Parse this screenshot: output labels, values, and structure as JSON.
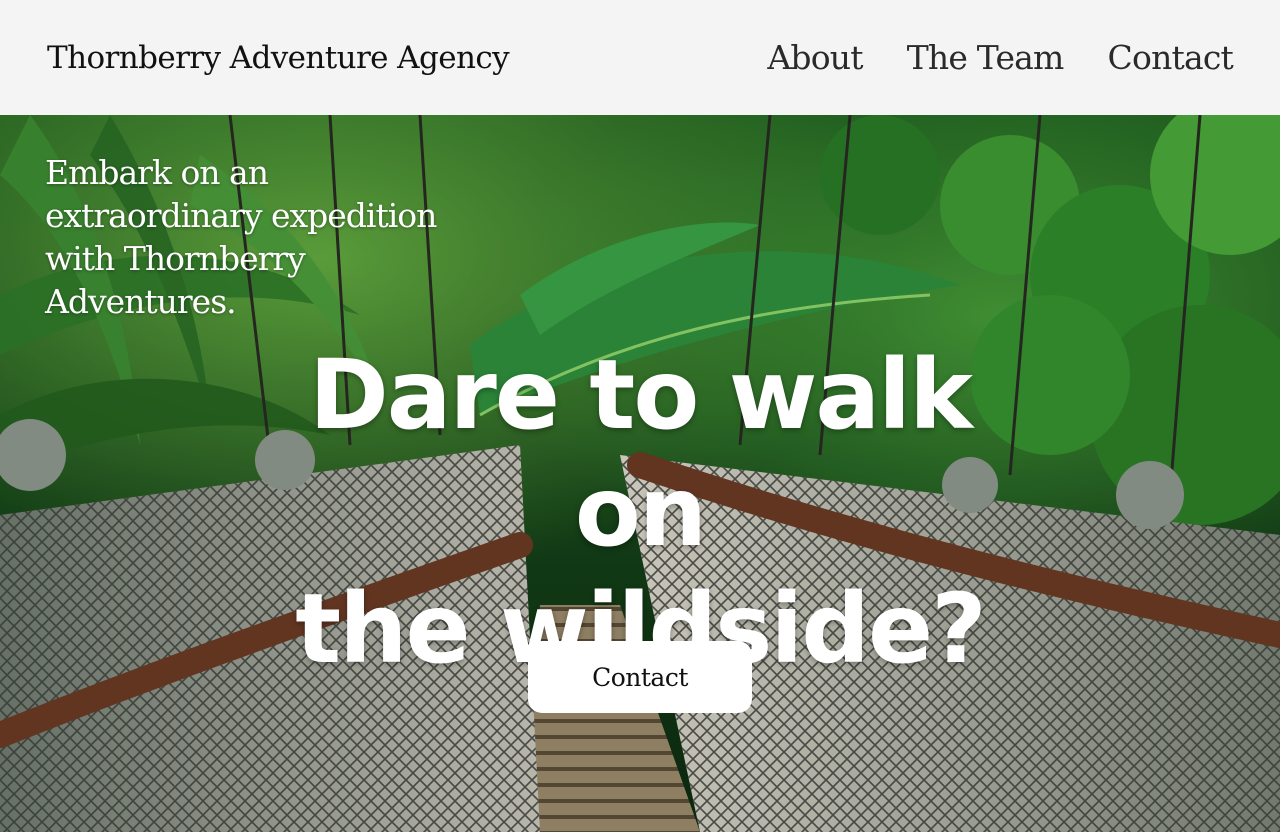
{
  "header": {
    "brand": "Thornberry Adventure Agency",
    "nav": [
      {
        "label": "About"
      },
      {
        "label": "The Team"
      },
      {
        "label": "Contact"
      }
    ]
  },
  "hero": {
    "tagline": "Embark on an extraordinary expedition with Thornberry Adventures.",
    "headline_line1": "Dare to walk on",
    "headline_line2": "the wildside?",
    "cta_label": "Contact",
    "background_image": "jungle rope suspension bridge"
  },
  "colors": {
    "nav_background": "#f4f4f4",
    "text_dark": "#111111",
    "hero_text": "#ffffff",
    "button_background": "#ffffff",
    "foliage_dark": "#123a16",
    "foliage_light": "#3f9a36"
  }
}
